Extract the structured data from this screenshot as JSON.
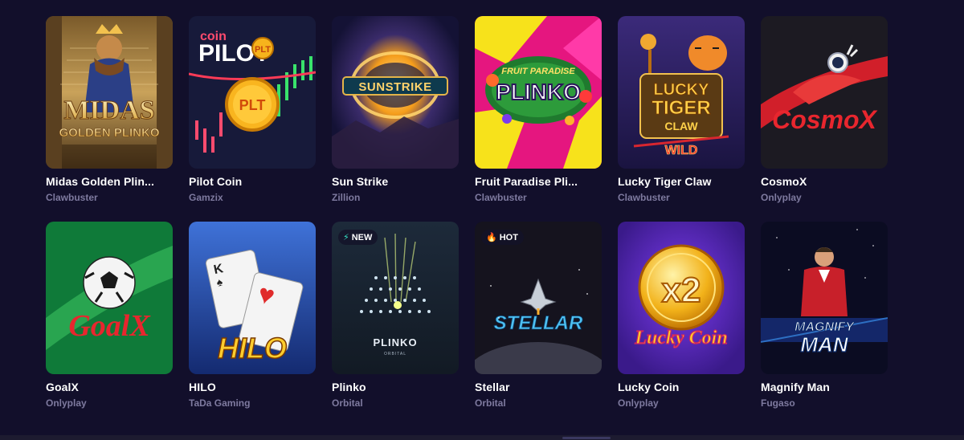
{
  "games": [
    {
      "title": "Midas Golden Plin...",
      "provider": "Clawbuster",
      "art_text": [
        "MIDAS",
        "GOLDEN PLINKO"
      ],
      "badge": null
    },
    {
      "title": "Pilot Coin",
      "provider": "Gamzix",
      "art_text": [
        "coin",
        "PILOT",
        "PLT",
        "PLT"
      ],
      "badge": null
    },
    {
      "title": "Sun Strike",
      "provider": "Zillion",
      "art_text": [
        "SUNSTRIKE"
      ],
      "badge": null
    },
    {
      "title": "Fruit Paradise Pli...",
      "provider": "Clawbuster",
      "art_text": [
        "FRUIT PARADISE",
        "PLINKO"
      ],
      "badge": null
    },
    {
      "title": "Lucky Tiger Claw",
      "provider": "Clawbuster",
      "art_text": [
        "LUCKY",
        "TIGER",
        "CLAW",
        "WILD"
      ],
      "badge": null
    },
    {
      "title": "CosmoX",
      "provider": "Onlyplay",
      "art_text": [
        "CosmoX"
      ],
      "badge": null
    },
    {
      "title": "GoalX",
      "provider": "Onlyplay",
      "art_text": [
        "GoalX"
      ],
      "badge": null
    },
    {
      "title": "HILO",
      "provider": "TaDa Gaming",
      "art_text": [
        "HILO"
      ],
      "badge": null
    },
    {
      "title": "Plinko",
      "provider": "Orbital",
      "art_text": [
        "PLINKO",
        "ORBITAL"
      ],
      "badge": {
        "label": "NEW",
        "icon": "lightning-icon",
        "glyph": "⚡",
        "color": "#35e0c4"
      }
    },
    {
      "title": "Stellar",
      "provider": "Orbital",
      "art_text": [
        "STELLAR"
      ],
      "badge": {
        "label": "HOT",
        "icon": "flame-icon",
        "glyph": "🔥",
        "color": "#ff4d6a"
      }
    },
    {
      "title": "Lucky Coin",
      "provider": "Onlyplay",
      "art_text": [
        "x2",
        "Lucky Coin"
      ],
      "badge": null
    },
    {
      "title": "Magnify Man",
      "provider": "Fugaso",
      "art_text": [
        "MAGNIFY",
        "MAN"
      ],
      "badge": null
    }
  ],
  "colors": {
    "background": "#120f2b",
    "title": "#ffffff",
    "provider": "#7e7a9f"
  }
}
